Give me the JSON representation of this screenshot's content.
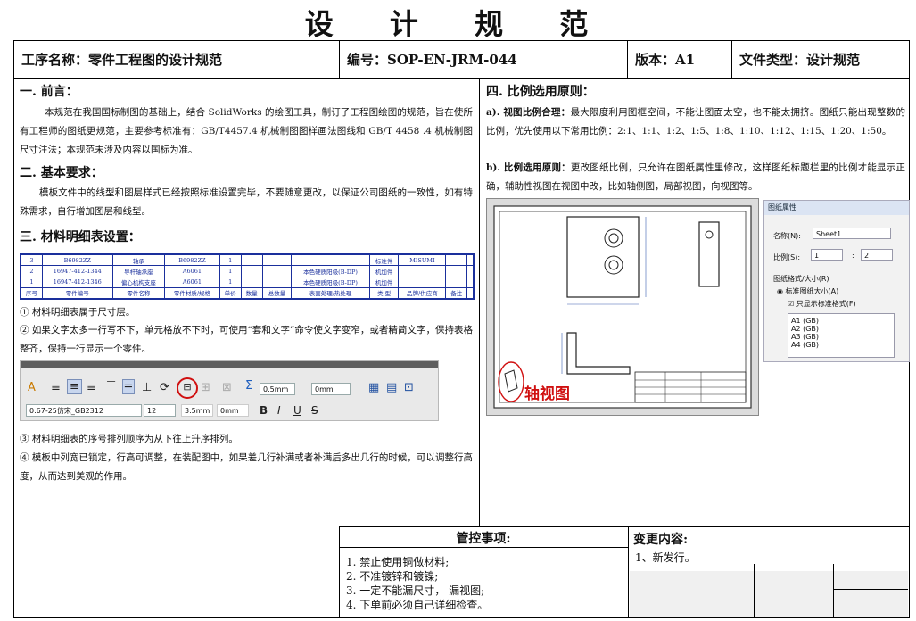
{
  "doc_title": "设 计 规 范",
  "header": {
    "process_label": "工序名称：零件工程图的设计规范",
    "code_label": "编号：SOP-EN-JRM-044",
    "version_label": "版本：A1",
    "type_label": "文件类型：设计规范"
  },
  "left": {
    "s1_title": "一. 前言：",
    "s1_text": "本规范在我国国标制图的基础上，结合 SolidWorks 的绘图工具，制订了工程图绘图的规范，旨在使所有工程师的图纸更规范，主要参考标准有：GB/T4457.4 机械制图图样画法图线和 GB/T 4458 .4 机械制图 尺寸注法；本规范未涉及内容以国标为准。",
    "s2_title": "二. 基本要求：",
    "s2_text": "模板文件中的线型和图层样式已经按照标准设置完毕，不要随意更改，以保证公司图纸的一致性，如有特殊需求，自行增加图层和线型。",
    "s3_title": "三. 材料明细表设置：",
    "bom_rows": [
      [
        "3",
        "B6982ZZ",
        "轴承",
        "B6982ZZ",
        "1",
        "",
        "",
        "",
        "标准件",
        "MISUMI",
        "",
        ""
      ],
      [
        "2",
        "16947-412-1344",
        "导杆轴承座",
        "A6061",
        "1",
        "",
        "",
        "本色硬质阳极(B-DP)",
        "机加件",
        "",
        "",
        ""
      ],
      [
        "1",
        "16947-412-1346",
        "偏心机构支座",
        "A6061",
        "1",
        "",
        "",
        "本色硬质阳极(B-DP)",
        "机加件",
        "",
        "",
        ""
      ],
      [
        "序号",
        "零件编号",
        "零件名称",
        "零件材质/规格",
        "单价",
        "数量",
        "总数量",
        "表面处理/热处理",
        "类 型",
        "品牌/供应商",
        "备注",
        ""
      ]
    ],
    "note1": "① 材料明细表属于尺寸层。",
    "note2": "② 如果文字太多一行写不下，单元格放不下时，可使用“套和文字”命令使文字变窄，或者精简文字，保持表格整齐，保持一行显示一个零件。",
    "toolbar": {
      "line_width": "0.5mm",
      "offset": "0mm",
      "font_name": "0.67-25仿宋_GB2312",
      "font_size": "12",
      "height": "3.5mm",
      "spacing": "0mm",
      "bold": "B",
      "italic": "I",
      "underline": "U",
      "strike": "S"
    },
    "note3": "③ 材料明细表的序号排列顺序为从下往上升序排列。",
    "note4": "④ 模板中列宽已锁定，行高可调整，在装配图中，如果差几行补满或者补满后多出几行的时候，可以调整行高度，从而达到美观的作用。"
  },
  "right": {
    "s4_title": "四. 比例选用原则：",
    "s4a_head": "a). 视图比例合理：",
    "s4a_text": "最大限度利用图框空间，不能让图面太空，也不能太拥挤。图纸只能出现整数的比例，优先使用以下常用比例：2:1、1:1、1:2、1:5、1:8、1:10、1:12、1:15、1:20、1:50。",
    "s4b_head": "b). 比例选用原则：",
    "s4b_text": "更改图纸比例，只允许在图纸属性里修改，这样图纸标题栏里的比例才能显示正确，辅助性视图在视图中改，比如轴侧图，局部视图，向视图等。",
    "axis_view_label": "轴视图",
    "props": {
      "title": "图纸属性",
      "name_label": "名称(N):",
      "name_value": "Sheet1",
      "scale_label": "比例(S):",
      "scale_a": "1",
      "scale_sep": ":",
      "scale_b": "2",
      "format_label": "图纸格式/大小(R)",
      "std_label": "标准图纸大小(A)",
      "only_std_label": "只显示标准格式(F)",
      "sizes": [
        "A1 (GB)",
        "A2 (GB)",
        "A3 (GB)",
        "A4 (GB)"
      ]
    }
  },
  "footer": {
    "control_title": "管控事项:",
    "control_items": [
      "1. 禁止使用铜做材料;",
      "2. 不准镀锌和镀镍;",
      "3. 一定不能漏尺寸， 漏视图;",
      "4. 下单前必须自己详细检查。"
    ],
    "change_title": "变更内容:",
    "change_text": "1、新发行。"
  }
}
